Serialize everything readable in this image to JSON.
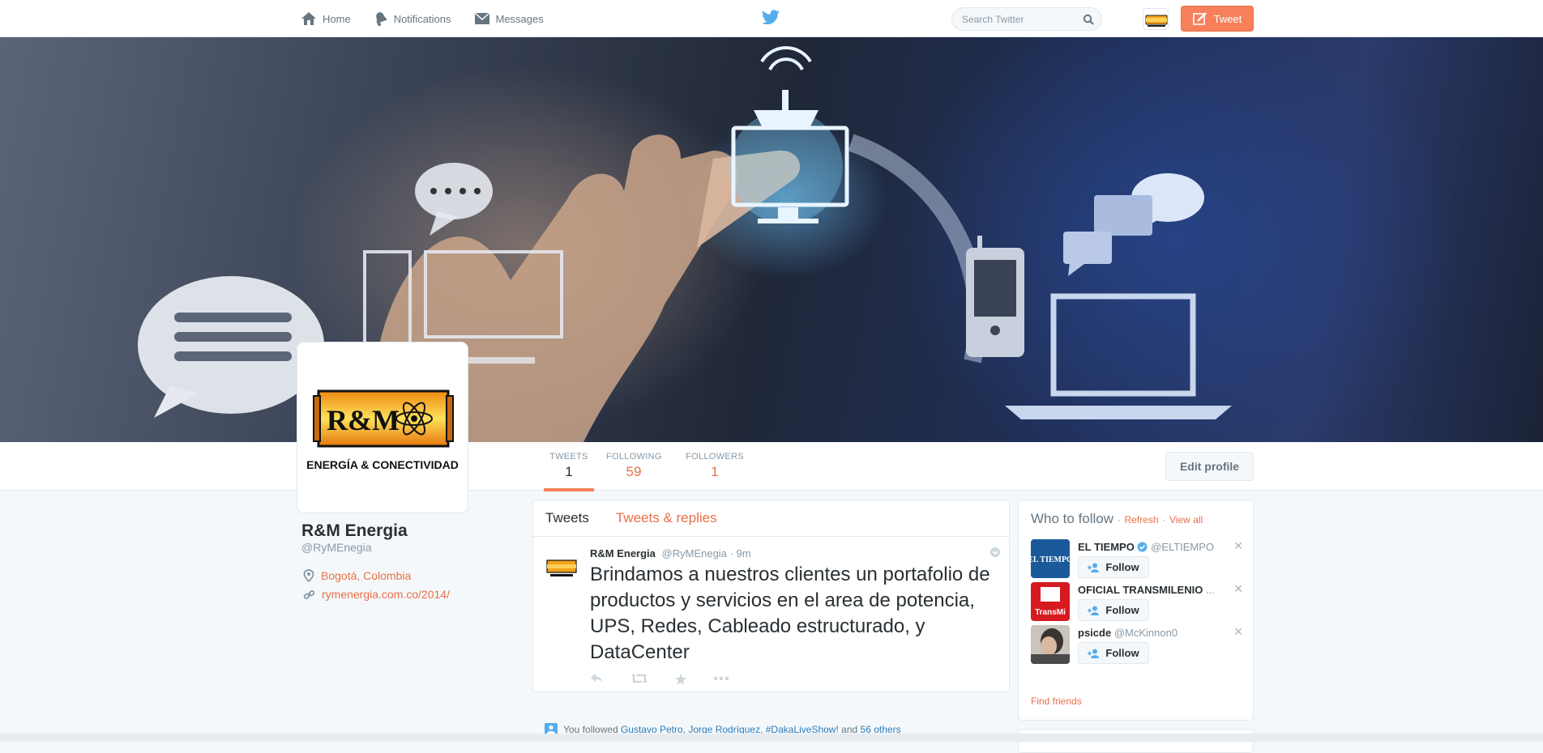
{
  "nav": {
    "home": "Home",
    "notifications": "Notifications",
    "messages": "Messages",
    "search_placeholder": "Search Twitter",
    "tweet_button": "Tweet"
  },
  "profile": {
    "name": "R&M Energia",
    "handle": "@RyMEnegia",
    "location": "Bogotá, Colombia",
    "website": "rymenergia.com.co/2014/",
    "logo_text": "R&M",
    "logo_subtext": "ENERGÍA & CONECTIVIDAD"
  },
  "stats": [
    {
      "label": "TWEETS",
      "value": "1"
    },
    {
      "label": "FOLLOWING",
      "value": "59"
    },
    {
      "label": "FOLLOWERS",
      "value": "1"
    }
  ],
  "edit_profile": "Edit profile",
  "timeline": {
    "tabs": [
      "Tweets",
      "Tweets & replies"
    ],
    "tweet": {
      "name": "R&M Energia",
      "handle": "@RyMEnegia",
      "time": "· 9m",
      "text": "Brindamos a nuestros clientes un portafolio de productos y servicios en el area de potencia, UPS, Redes, Cableado estructurado, y DataCenter"
    }
  },
  "followed": {
    "prefix": "You followed",
    "names": [
      "Gustavo Petro",
      "Jorge Rodríguez",
      "#DakaLiveShow!"
    ],
    "and": "and",
    "others": "56 others"
  },
  "who_to_follow": {
    "title": "Who to follow",
    "refresh": "Refresh",
    "view_all": "View all",
    "follow_label": "Follow",
    "find_friends": "Find friends",
    "items": [
      {
        "name": "EL TIEMPO",
        "handle": "@ELTIEMPO",
        "avatar_text": "EL TIEMPO",
        "color": "#1a5a9a"
      },
      {
        "name": "OFICIAL TRANSMILENIO",
        "handle": "...",
        "avatar_text": "TransMi",
        "color": "#d71920"
      },
      {
        "name": "psicde",
        "handle": "@McKinnon0",
        "avatar_text": "",
        "color": "#555555"
      }
    ]
  },
  "colors": {
    "accent": "#f7805b",
    "link": "#e87048",
    "blue_link": "#2b7bb9",
    "twitter_blue": "#55acee"
  }
}
